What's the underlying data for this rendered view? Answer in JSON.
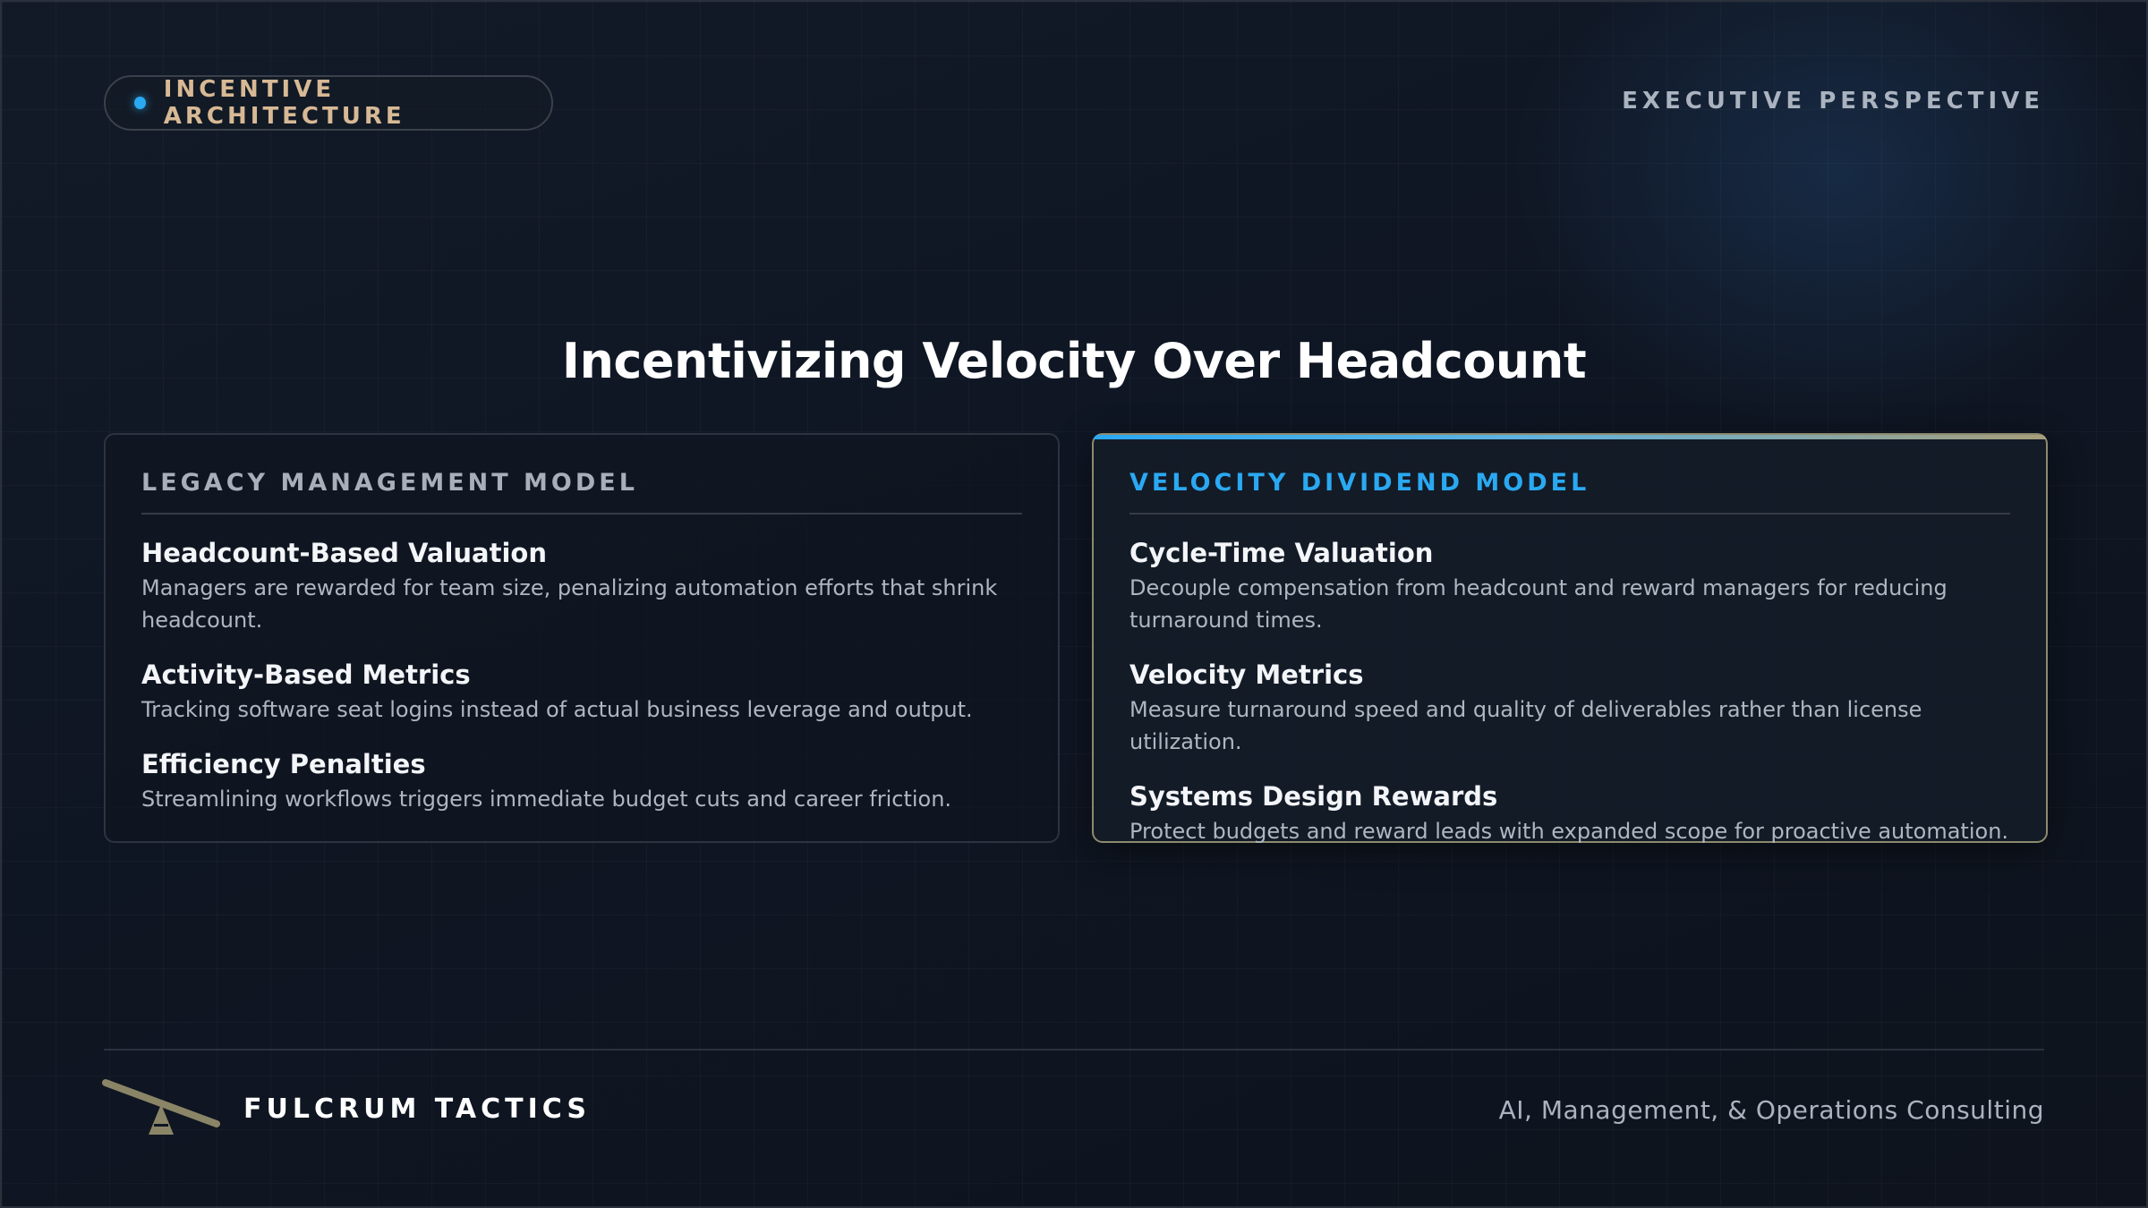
{
  "header": {
    "badge_label": "INCENTIVE ARCHITECTURE",
    "perspective_label": "EXECUTIVE PERSPECTIVE"
  },
  "title": "Incentivizing Velocity Over Headcount",
  "cards": [
    {
      "heading": "LEGACY MANAGEMENT MODEL",
      "items": [
        {
          "title": "Headcount-Based Valuation",
          "desc": "Managers are rewarded for team size, penalizing automation efforts that shrink headcount."
        },
        {
          "title": "Activity-Based Metrics",
          "desc": "Tracking software seat logins instead of actual business leverage and output."
        },
        {
          "title": "Efficiency Penalties",
          "desc": "Streamlining workflows triggers immediate budget cuts and career friction."
        }
      ]
    },
    {
      "heading": "VELOCITY DIVIDEND MODEL",
      "items": [
        {
          "title": "Cycle-Time Valuation",
          "desc": "Decouple compensation from headcount and reward managers for reducing turnaround times."
        },
        {
          "title": "Velocity Metrics",
          "desc": "Measure turnaround speed and quality of deliverables rather than license utilization."
        },
        {
          "title": "Systems Design Rewards",
          "desc": "Protect budgets and reward leads with expanded scope for proactive automation."
        }
      ]
    }
  ],
  "footer": {
    "brand": "FULCRUM TACTICS",
    "tagline": "AI, Management, & Operations Consulting",
    "logo_icon": "fulcrum-lever-icon"
  },
  "colors": {
    "accent_blue": "#2aa9f2",
    "badge_gold": "#d7b995",
    "logo_olive": "#8a8566"
  }
}
